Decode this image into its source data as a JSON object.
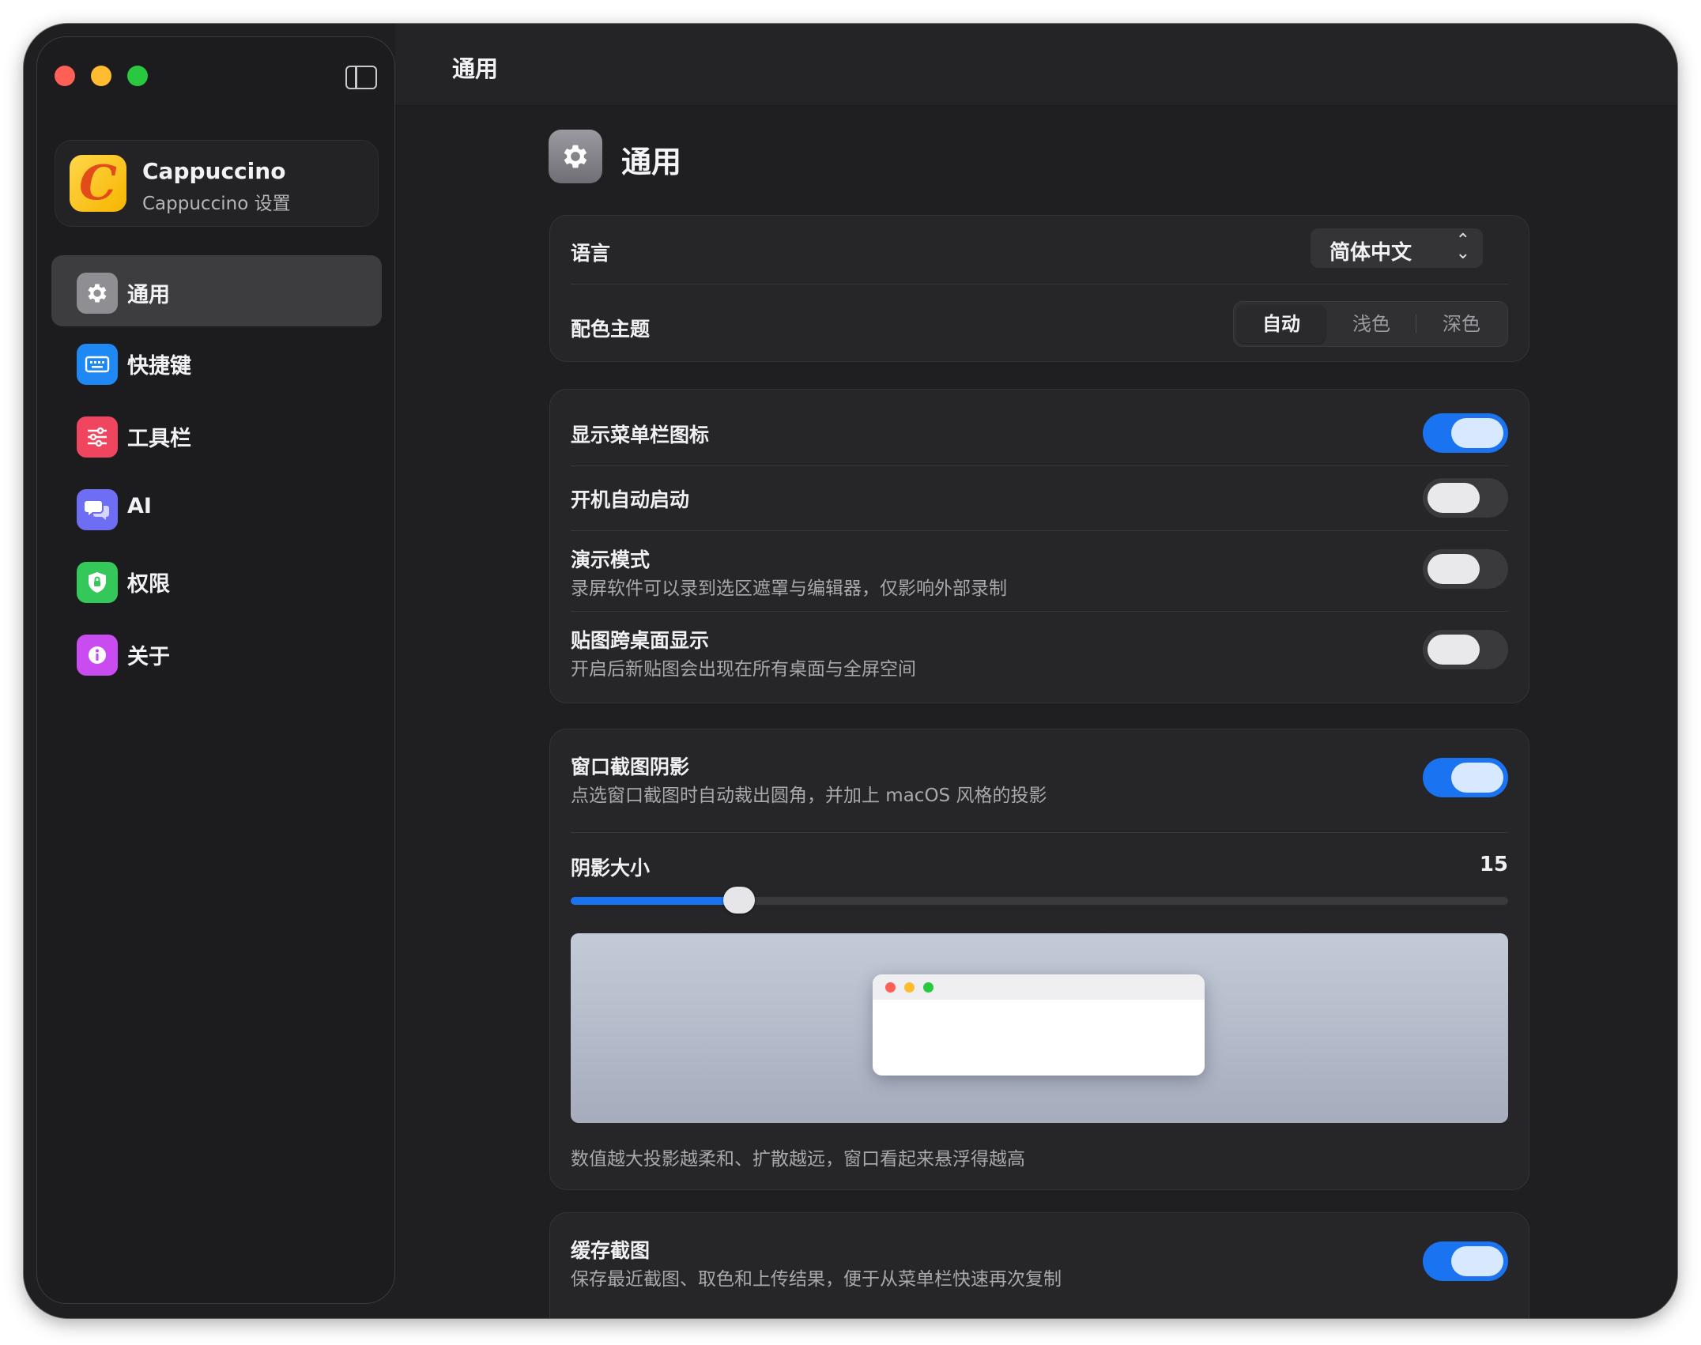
{
  "window": {
    "title": "通用"
  },
  "sidebar": {
    "app_name": "Cappuccino",
    "app_subtitle": "Cappuccino 设置",
    "app_logo_letter": "C",
    "items": [
      {
        "label": "通用",
        "icon": "gear-icon",
        "color": "#8e8e93"
      },
      {
        "label": "快捷键",
        "icon": "keyboard-icon",
        "color": "#1e88f5"
      },
      {
        "label": "工具栏",
        "icon": "sliders-icon",
        "color": "#f0455e"
      },
      {
        "label": "AI",
        "icon": "chat-bubbles-icon",
        "color": "#6e6ef5"
      },
      {
        "label": "权限",
        "icon": "lock-shield-icon",
        "color": "#34c759"
      },
      {
        "label": "关于",
        "icon": "info-icon",
        "color": "#c94cf0"
      }
    ]
  },
  "page": {
    "title": "通用"
  },
  "language": {
    "label": "语言",
    "value": "简体中文"
  },
  "theme": {
    "label": "配色主题",
    "options": [
      "自动",
      "浅色",
      "深色"
    ],
    "selected": "自动"
  },
  "toggles": {
    "menubar_icon": {
      "label": "显示菜单栏图标",
      "on": true
    },
    "launch_at_login": {
      "label": "开机自动启动",
      "on": false
    },
    "presentation": {
      "label": "演示模式",
      "desc": "录屏软件可以录到选区遮罩与编辑器，仅影响外部录制",
      "on": false
    },
    "pin_all_spaces": {
      "label": "贴图跨桌面显示",
      "desc": "开启后新贴图会出现在所有桌面与全屏空间",
      "on": false
    },
    "window_shadow": {
      "label": "窗口截图阴影",
      "desc": "点选窗口截图时自动裁出圆角，并加上 macOS 风格的投影",
      "on": true
    },
    "cache": {
      "label": "缓存截图",
      "desc": "保存最近截图、取色和上传结果，便于从菜单栏快速再次复制",
      "on": true
    }
  },
  "shadow_size": {
    "label": "阴影大小",
    "value": "15",
    "fraction": 0.18,
    "hint": "数值越大投影越柔和、扩散越远，窗口看起来悬浮得越高"
  },
  "colors": {
    "accent": "#1a73f0",
    "window_bg": "#1f1f21",
    "card_bg": "#262628"
  }
}
